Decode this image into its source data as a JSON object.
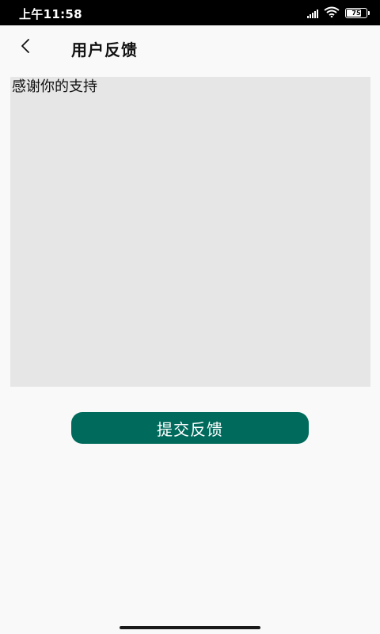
{
  "status_bar": {
    "time": "上午11:58",
    "battery_level": "75",
    "battery_percent": 75
  },
  "header": {
    "title": "用户反馈",
    "back_icon": "chevron-left-icon"
  },
  "feedback": {
    "value": "感谢你的支持",
    "placeholder": ""
  },
  "actions": {
    "submit_label": "提交反馈"
  },
  "colors": {
    "accent": "#006b5c",
    "input_background": "#e6e6e6",
    "page_background": "#f9f9f9",
    "status_bar": "#000000"
  }
}
